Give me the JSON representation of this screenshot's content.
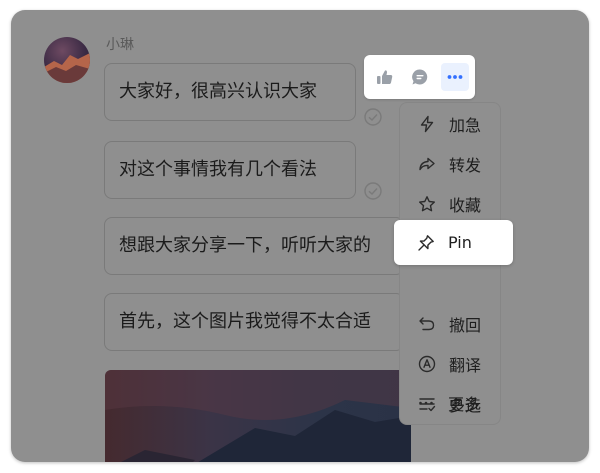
{
  "sender": {
    "name": "小琳"
  },
  "messages": [
    {
      "text": "大家好，很高兴认识大家",
      "read": true
    },
    {
      "text": "对这个事情我有几个看法",
      "read": true
    },
    {
      "text": "想跟大家分享一下，听听大家的",
      "read": false
    },
    {
      "text": "首先，这个图片我觉得不太合适",
      "read": false
    }
  ],
  "reaction_bar": {
    "items": [
      {
        "icon": "thumbs-up-icon"
      },
      {
        "icon": "reply-bubble-icon"
      },
      {
        "icon": "more-dots-icon"
      }
    ]
  },
  "context_menu": {
    "items": [
      {
        "label": "加急",
        "icon": "lightning-icon"
      },
      {
        "label": "转发",
        "icon": "forward-icon"
      },
      {
        "label": "收藏",
        "icon": "star-icon"
      },
      {
        "label": "Pin",
        "icon": "pin-icon"
      },
      {
        "label": "撤回",
        "icon": "undo-icon"
      },
      {
        "label": "翻译",
        "icon": "translate-icon"
      },
      {
        "label": "多选",
        "icon": "multi-select-icon"
      },
      {
        "label": "更多",
        "icon": "ellipsis-icon"
      }
    ]
  },
  "colors": {
    "overlay": "#8f8f8f",
    "accent": "#3370ff",
    "highlight_bg": "#ffffff"
  }
}
